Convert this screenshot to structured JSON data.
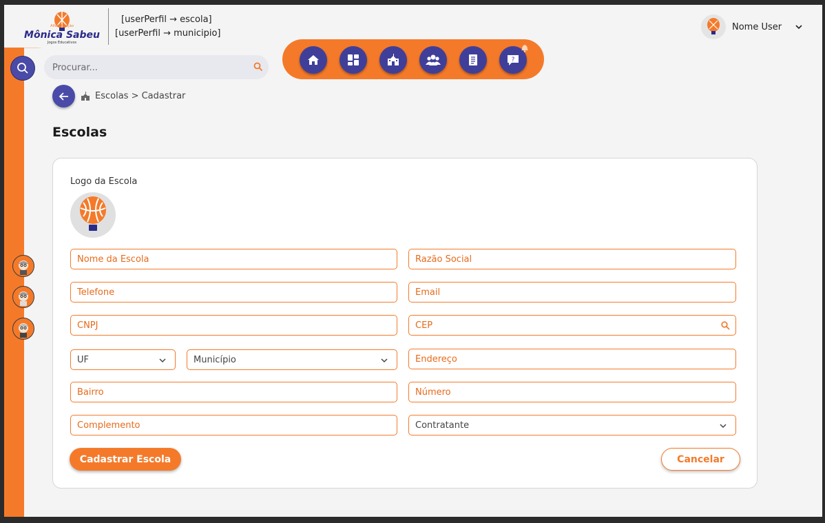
{
  "header": {
    "logo_alt": "Monica Sabeu",
    "perfil_line1": "[userPerfil → escola]",
    "perfil_line2": "[userPerfil → municipio]",
    "user_name": "Nome User"
  },
  "search": {
    "placeholder": "Procurar..."
  },
  "nav": {
    "items": [
      "home-icon",
      "dashboard-icon",
      "school-icon",
      "users-icon",
      "document-icon",
      "help-icon"
    ]
  },
  "breadcrumb": {
    "text": "Escolas > Cadastrar"
  },
  "page": {
    "title": "Escolas"
  },
  "form": {
    "logo_label": "Logo da Escola",
    "nome": "Nome da Escola",
    "razao": "Razão Social",
    "telefone": "Telefone",
    "email": "Email",
    "cnpj": "CNPJ",
    "cep": "CEP",
    "uf": "UF",
    "municipio": "Município",
    "endereco": "Endereço",
    "bairro": "Bairro",
    "numero": "Número",
    "complemento": "Complemento",
    "contratante": "Contratante",
    "submit": "Cadastrar Escola",
    "cancel": "Cancelar"
  },
  "colors": {
    "accent": "#f47a2a",
    "primary": "#3f3f9a"
  }
}
